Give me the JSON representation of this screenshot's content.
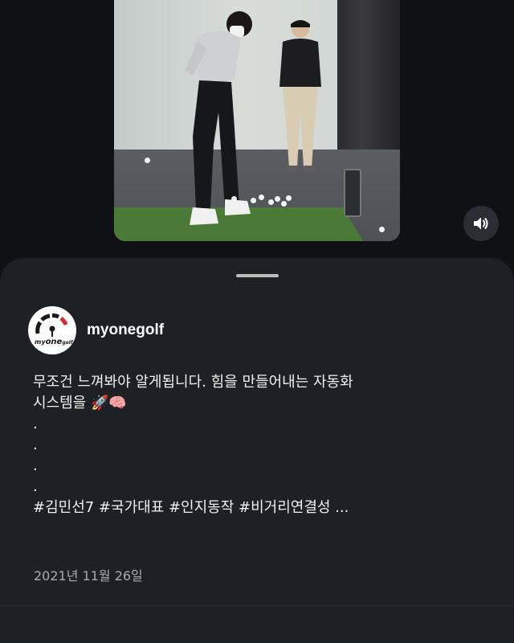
{
  "post": {
    "username": "myonegolf",
    "caption_line1": "무조건 느껴봐야 알게됩니다. 힘을 만들어내는 자동화",
    "caption_line2": "시스템을 🚀🧠",
    "dots": [
      ".",
      ".",
      ".",
      "."
    ],
    "hashtags": "#김민선7 #국가대표 #인지동작 #비거리연결성 ...",
    "date": "2021년 11월 26일"
  },
  "avatar": {
    "logo_text": "my",
    "logo_text_accent": "one",
    "logo_text_tail": "golf",
    "accent_color": "#e0262d"
  },
  "icons": {
    "sound": "speaker-sound-on-icon"
  },
  "colors": {
    "background": "#0f1115",
    "sheet": "#1f2025",
    "date_text": "#a9abb0"
  }
}
